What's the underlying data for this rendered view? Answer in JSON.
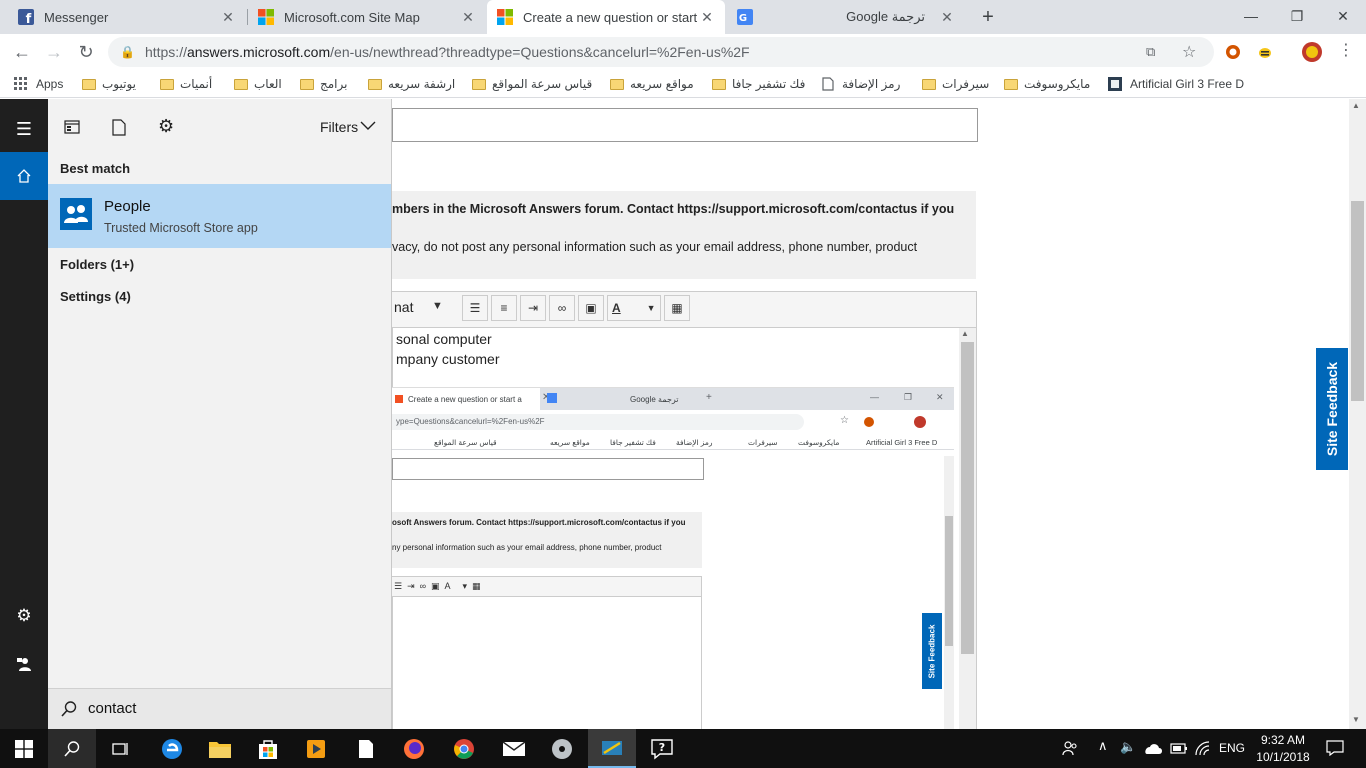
{
  "browser": {
    "tabs": [
      {
        "title": "Messenger",
        "active": false
      },
      {
        "title": "Microsoft.com Site Map",
        "active": false
      },
      {
        "title": "Create a new question or start a",
        "active": true
      },
      {
        "title": "Google ترجمة",
        "active": false
      }
    ],
    "new_tab": "+",
    "window": {
      "minimize": "—",
      "maximize": "❐",
      "close": "✕"
    },
    "url": {
      "scheme": "https://",
      "host": "answers.microsoft.com",
      "path": "/en-us/newthread?threadtype=Questions&cancelurl=%2Fen-us%2F"
    },
    "bookmarks": [
      {
        "label": "Apps",
        "kind": "apps"
      },
      {
        "label": "يوتيوب",
        "kind": "folder"
      },
      {
        "label": "أنميات",
        "kind": "folder"
      },
      {
        "label": "العاب",
        "kind": "folder"
      },
      {
        "label": "برامج",
        "kind": "folder"
      },
      {
        "label": "ارشفة سريعه",
        "kind": "folder"
      },
      {
        "label": "قياس سرعة المواقع",
        "kind": "folder"
      },
      {
        "label": "مواقع سريعه",
        "kind": "folder"
      },
      {
        "label": "فك تشفير جافا",
        "kind": "folder"
      },
      {
        "label": "رمز الإضافة",
        "kind": "page"
      },
      {
        "label": "سيرفرات",
        "kind": "folder"
      },
      {
        "label": "مايكروسوفت",
        "kind": "folder"
      },
      {
        "label": "Artificial Girl 3 Free D",
        "kind": "site"
      }
    ]
  },
  "page": {
    "notice_line1": "mbers in the Microsoft Answers forum. Contact https://support.microsoft.com/contactus if you",
    "notice_line2": "vacy, do not post any personal information such as your email address, phone number, product",
    "format_label": "nat",
    "editor_line1": "sonal computer",
    "editor_line2": "mpany customer",
    "site_feedback": "Site Feedback",
    "nested": {
      "tab_active": "Create a new question or start a",
      "tab_other": "Google ترجمة",
      "url": "ype=Questions&cancelurl=%2Fen-us%2F",
      "bookmarks": [
        "قياس سرعة المواقع",
        "مواقع سريعه",
        "فك تشفير جافا",
        "رمز الإضافة",
        "سيرفرات",
        "مايكروسوفت",
        "Artificial Girl 3 Free D"
      ],
      "notice_line1": "osoft Answers forum. Contact https://support.microsoft.com/contactus if you",
      "notice_line2": "ny personal information such as your email address, phone number, product",
      "site_feedback": "Site Feedback"
    }
  },
  "start_menu": {
    "filters_label": "Filters",
    "best_match_heading": "Best match",
    "best_match": {
      "title": "People",
      "subtitle": "Trusted Microsoft Store app"
    },
    "folders": "Folders (1+)",
    "settings": "Settings (4)",
    "search_value": "contact"
  },
  "taskbar": {
    "language": "ENG",
    "time": "9:32 AM",
    "date": "10/1/2018"
  },
  "colors": {
    "accent_blue": "#0067b8",
    "selection": "#b4d7f4",
    "start_rail": "#1f1f1f",
    "taskbar": "#101010"
  }
}
